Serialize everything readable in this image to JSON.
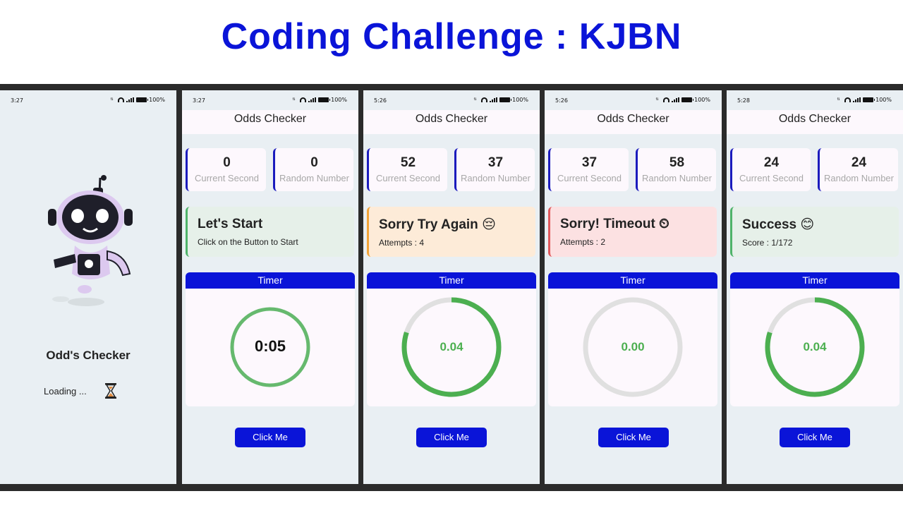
{
  "title": "Coding Challenge : KJBN",
  "colors": {
    "accent": "#0a14d8",
    "progress": "#4caf50",
    "track": "#e0e0e0"
  },
  "splash": {
    "time": "3:27",
    "battery": "100%",
    "app_name": "Odd's Checker",
    "loading": "Loading ...",
    "loading_icon": "hourglass-icon"
  },
  "screens": [
    {
      "time": "3:27",
      "battery": "100%",
      "app_title": "Odds Checker",
      "current_second": "0",
      "current_second_label": "Current Second",
      "random_number": "0",
      "random_number_label": "Random Number",
      "status_title": "Let's Start",
      "status_sub": "Click on the Button to Start",
      "status_type": "neutral",
      "timer_label": "Timer",
      "timer_value": "0:05",
      "timer_progress": 1.0,
      "timer_style": "full-light",
      "button": "Click Me"
    },
    {
      "time": "5:26",
      "battery": "100%",
      "app_title": "Odds Checker",
      "current_second": "52",
      "current_second_label": "Current Second",
      "random_number": "37",
      "random_number_label": "Random Number",
      "status_title": "Sorry Try Again 😔",
      "status_sub": "Attempts : 4",
      "status_type": "warn",
      "timer_label": "Timer",
      "timer_value": "0.04",
      "timer_progress": 0.8,
      "timer_style": "partial",
      "button": "Click Me"
    },
    {
      "time": "5:26",
      "battery": "100%",
      "app_title": "Odds Checker",
      "current_second": "37",
      "current_second_label": "Current Second",
      "random_number": "58",
      "random_number_label": "Random Number",
      "status_title": "Sorry! Timeout ⏲",
      "status_sub": "Attempts : 2",
      "status_type": "error",
      "timer_label": "Timer",
      "timer_value": "0.00",
      "timer_progress": 0.0,
      "timer_style": "partial",
      "button": "Click Me"
    },
    {
      "time": "5:28",
      "battery": "100%",
      "app_title": "Odds Checker",
      "current_second": "24",
      "current_second_label": "Current Second",
      "random_number": "24",
      "random_number_label": "Random Number",
      "status_title": "Success 😊",
      "status_sub": "Score : 1/172",
      "status_type": "ok",
      "timer_label": "Timer",
      "timer_value": "0.04",
      "timer_progress": 0.8,
      "timer_style": "partial",
      "button": "Click Me"
    }
  ]
}
